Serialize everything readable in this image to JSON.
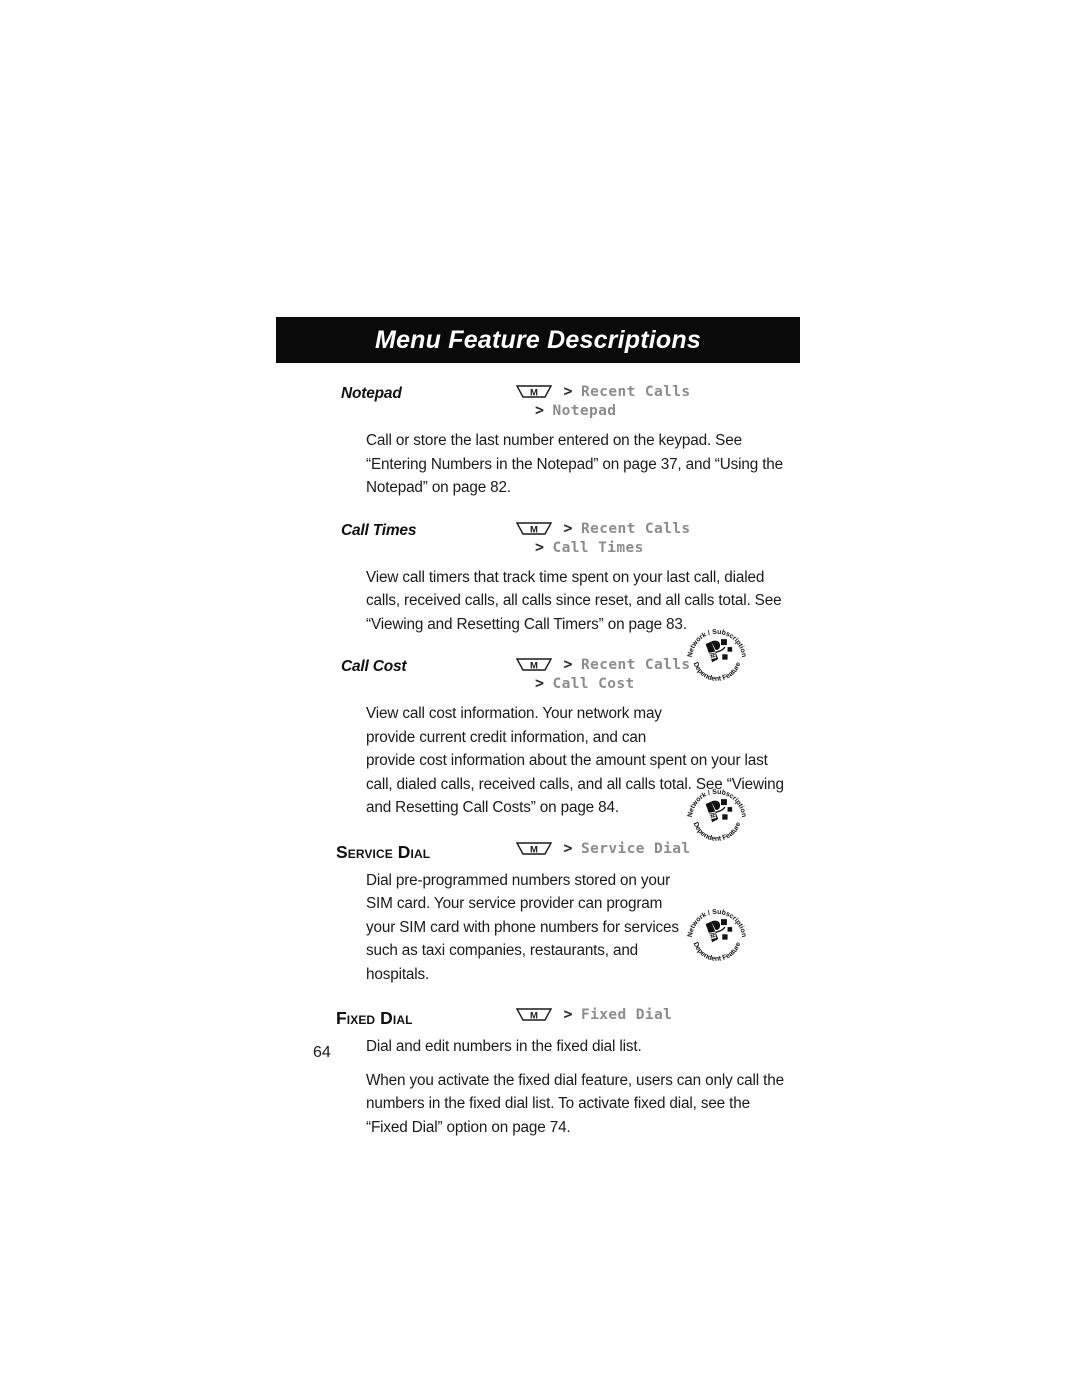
{
  "header": {
    "title": "Menu Feature Descriptions"
  },
  "icons": {
    "menu_key_label": "M",
    "menu_key_name": "menu-key-icon",
    "badge_top_text": "Network / Subscription",
    "badge_bottom_text": "Dependent Feature",
    "path_separator": ">"
  },
  "entries": [
    {
      "term": "Notepad",
      "term_style": "italic",
      "path": [
        "Recent Calls",
        "Notepad"
      ],
      "badge": false,
      "paragraphs": [
        "Call or store the last number entered on the keypad. See “Entering Numbers in the Notepad” on page 37, and “Using the Notepad” on page 82."
      ]
    },
    {
      "term": "Call Times",
      "term_style": "italic",
      "path": [
        "Recent Calls",
        "Call Times"
      ],
      "badge": false,
      "paragraphs": [
        "View call timers that track time spent on your last call, dialed calls, received calls, all calls since reset, and all calls total. See “Viewing and Resetting Call Timers” on page 83."
      ]
    },
    {
      "term": "Call Cost",
      "term_style": "italic",
      "path": [
        "Recent Calls",
        "Call Cost"
      ],
      "badge": true,
      "paragraphs": [
        "View call cost information. Your network may provide current credit information, and can",
        "provide cost information about the amount spent on your last call, dialed calls, received calls, and all calls total. See “Viewing and Resetting Call Costs” on page 84."
      ]
    },
    {
      "term": "Service Dial",
      "term_style": "smallcaps",
      "path": [
        "Service Dial"
      ],
      "badge": true,
      "paragraphs": [
        "Dial pre-programmed numbers stored on your SIM card. Your service provider can program your SIM card with phone numbers for services such as taxi companies, restaurants, and hospitals."
      ]
    },
    {
      "term": "Fixed Dial",
      "term_style": "smallcaps",
      "path": [
        "Fixed Dial"
      ],
      "badge": true,
      "paragraphs": [
        "Dial and edit numbers in the fixed dial list.",
        "When you activate the fixed dial feature, users can only call the numbers in the fixed dial list. To activate fixed dial, see the “Fixed Dial” option on page 74."
      ]
    }
  ],
  "footer": {
    "page_number": "64"
  },
  "colors": {
    "header_bg": "#0a0a0a",
    "header_text": "#ffffff",
    "body_text": "#1a1a1a",
    "path_text": "#8c8c8c",
    "page_bg": "#ffffff"
  }
}
